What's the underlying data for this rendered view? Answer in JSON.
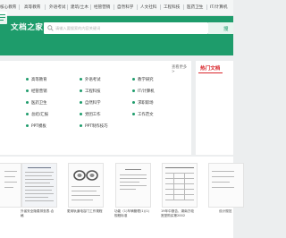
{
  "nav": {
    "items": [
      "核心教育",
      "高等教育",
      "外语考试",
      "建筑/土木",
      "经管营销",
      "自然科学",
      "人文社科",
      "工程科技",
      "医药卫生",
      "IT/计算机"
    ]
  },
  "header": {
    "site_name": "文档之家"
  },
  "search": {
    "placeholder": "请输入要搜索的内容关键词",
    "button_label": "搜"
  },
  "categories": {
    "more_label": "查看更多 >",
    "items": [
      "高等教育",
      "外语考试",
      "教学研究",
      "经管营销",
      "工程科技",
      "IT/计算机",
      "医药卫生",
      "自然科学",
      "求职职场",
      "总结/汇报",
      "党团工作",
      "工作范文",
      "PPT模板",
      "PPT制作技巧"
    ]
  },
  "hot": {
    "title": "热门文档"
  },
  "docs": {
    "items": [
      {
        "title": ""
      },
      {
        "title": "外省安全隐患排查表-合格"
      },
      {
        "title": "更用轨道电容门工作规程"
      },
      {
        "title": "功能（1)车辆管理(1)(1) 规程标准"
      },
      {
        "title": "19年中报告、湖南方较宽型购买第2002"
      },
      {
        "title": "设计规范"
      }
    ]
  },
  "colors": {
    "brand": "#1e9c6b",
    "hot_accent": "#d9262b",
    "page_bg": "#eceeef"
  }
}
